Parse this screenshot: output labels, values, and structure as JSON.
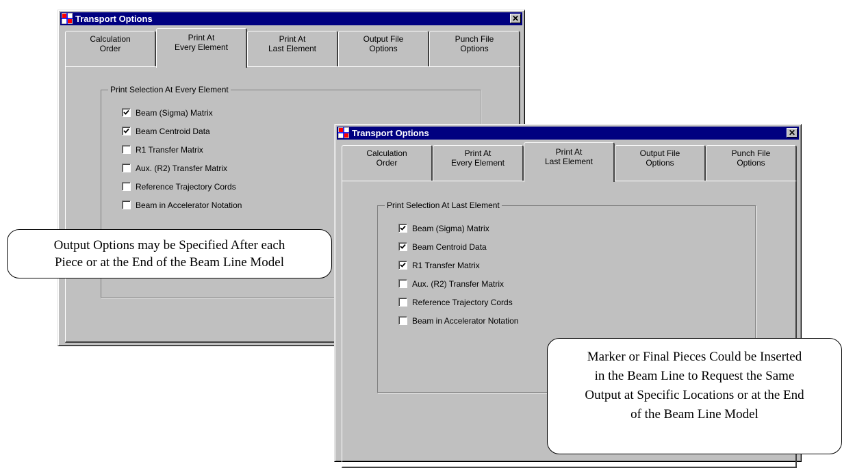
{
  "window_1": {
    "title": "Transport Options",
    "close_glyph": "✕",
    "tabs": [
      {
        "line1": "Calculation",
        "line2": "Order"
      },
      {
        "line1": "Print At",
        "line2": "Every Element"
      },
      {
        "line1": "Print At",
        "line2": "Last Element"
      },
      {
        "line1": "Output File",
        "line2": "Options"
      },
      {
        "line1": "Punch File",
        "line2": "Options"
      }
    ],
    "active_tab": 1,
    "group_title": "Print Selection At Every Element",
    "checkboxes": [
      {
        "label": "Beam (Sigma) Matrix",
        "checked": true
      },
      {
        "label": "Beam Centroid Data",
        "checked": true
      },
      {
        "label": "R1 Transfer Matrix",
        "checked": false
      },
      {
        "label": "Aux. (R2) Transfer Matrix",
        "checked": false
      },
      {
        "label": "Reference Trajectory Cords",
        "checked": false
      },
      {
        "label": "Beam in Accelerator Notation",
        "checked": false
      }
    ]
  },
  "window_2": {
    "title": "Transport Options",
    "close_glyph": "✕",
    "tabs": [
      {
        "line1": "Calculation",
        "line2": "Order"
      },
      {
        "line1": "Print At",
        "line2": "Every Element"
      },
      {
        "line1": "Print At",
        "line2": "Last Element"
      },
      {
        "line1": "Output File",
        "line2": "Options"
      },
      {
        "line1": "Punch File",
        "line2": "Options"
      }
    ],
    "active_tab": 2,
    "group_title": "Print Selection At Last Element",
    "checkboxes": [
      {
        "label": "Beam (Sigma) Matrix",
        "checked": true
      },
      {
        "label": "Beam Centroid Data",
        "checked": true
      },
      {
        "label": "R1 Transfer Matrix",
        "checked": true
      },
      {
        "label": "Aux. (R2) Transfer Matrix",
        "checked": false
      },
      {
        "label": "Reference Trajectory Cords",
        "checked": false
      },
      {
        "label": "Beam in Accelerator Notation",
        "checked": false
      }
    ]
  },
  "callout_1": {
    "line1": "Output Options may be Specified After each",
    "line2": "Piece or at the End of the Beam Line Model"
  },
  "callout_2": {
    "line1": "Marker or Final Pieces Could be Inserted",
    "line2": "in the Beam Line to Request the Same",
    "line3": "Output at Specific Locations or at the End",
    "line4": "of the Beam Line Model"
  },
  "icons": {
    "app": "transport-app-icon",
    "close": "close-icon",
    "check": "checkmark-icon"
  },
  "colors": {
    "titlebar": "#000080",
    "face": "#c0c0c0"
  }
}
